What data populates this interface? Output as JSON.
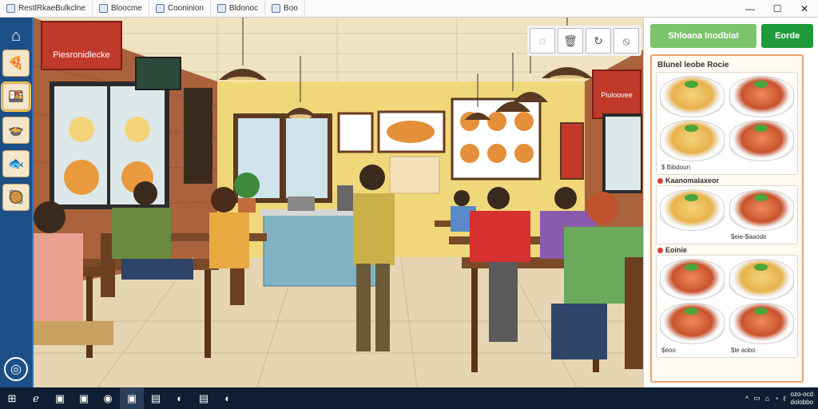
{
  "window": {
    "tabs": [
      {
        "label": "RestlRkaeBulkclne"
      },
      {
        "label": "Bloocme"
      },
      {
        "label": "Cooninion"
      },
      {
        "label": "Bldonoc"
      },
      {
        "label": "Boo"
      }
    ],
    "controls": [
      "—",
      "☐",
      "✕"
    ]
  },
  "left_rail": {
    "items": [
      "home-icon",
      "pizza-icon",
      "meal-icon",
      "bowl-icon",
      "chef-icon",
      "soup-icon"
    ],
    "settings_icon": "◎"
  },
  "scene": {
    "restaurant_sign": "Piesronidlecke",
    "right_sign": "Piuloovee",
    "tools": [
      "◌",
      "🗑",
      "↻",
      "⦸"
    ]
  },
  "panel": {
    "buttons": {
      "primary": "Shloana Inodbiat",
      "secondary": "Eorde"
    },
    "menu_title": "Blunel leobe Rocie",
    "sections": [
      {
        "title": "",
        "dishes": [
          "noodle",
          "red",
          "noodle",
          "red"
        ],
        "prices": [
          "$ Bibdoun",
          ""
        ]
      },
      {
        "title": "Kaanomalaxeor",
        "dishes": [
          "noodle",
          "red"
        ],
        "prices": [
          "",
          "$eie-$aaode"
        ]
      },
      {
        "title": "Eoinie",
        "dishes": [
          "red",
          "noodle",
          "red",
          "red"
        ],
        "prices": [
          "$eoo",
          "$le aobo"
        ]
      }
    ]
  },
  "taskbar": {
    "icons": [
      "⊞",
      "ℯ",
      "▣",
      "▣",
      "◉",
      "▣",
      "▤",
      "◐",
      "▤",
      "◐"
    ],
    "tray": [
      "^",
      "▭",
      "⌂",
      "◔",
      "ℓ"
    ],
    "clock": {
      "time": "ozo-ocd",
      "date": "dolobbo"
    }
  },
  "colors": {
    "rail": "#1b4f86",
    "accent_green": "#1f9a3a",
    "menu_border": "#e9a46a"
  }
}
